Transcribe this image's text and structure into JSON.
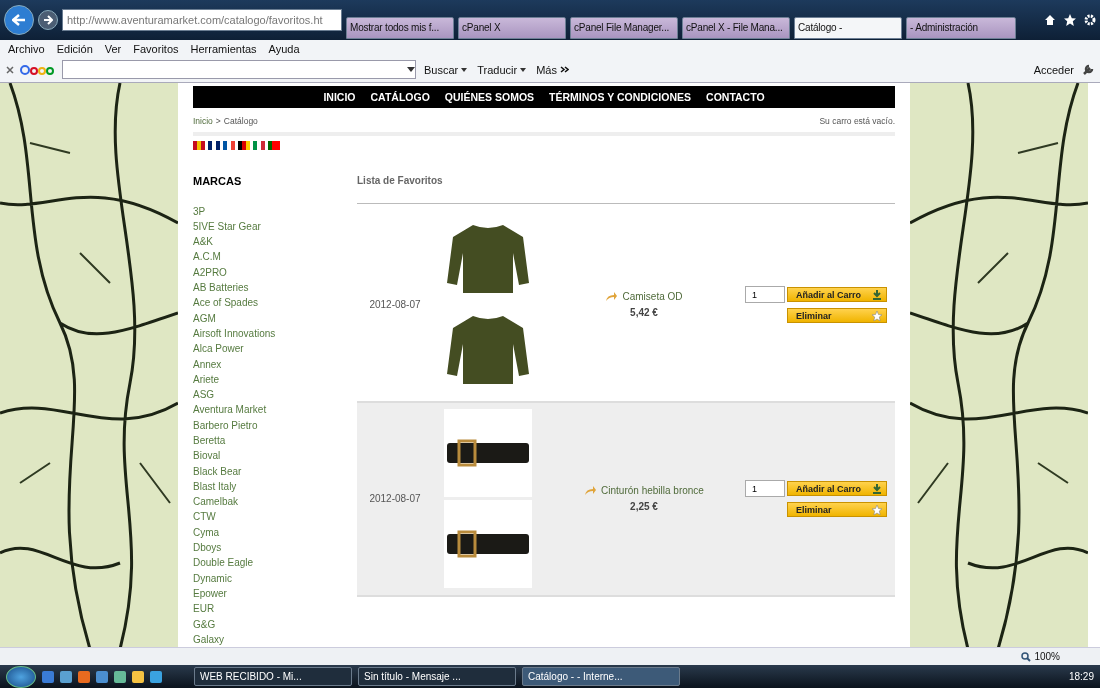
{
  "browser": {
    "address": "http://www.aventuramarket.com/catalogo/favoritos.ht",
    "tabs": [
      {
        "label": "Mostrar todos mis f...",
        "selected": false
      },
      {
        "label": "cPanel X",
        "selected": false
      },
      {
        "label": "cPanel File Manager...",
        "selected": false
      },
      {
        "label": "cPanel X - File Mana...",
        "selected": false
      },
      {
        "label": "Catálogo -",
        "selected": true
      },
      {
        "label": "- Administración",
        "selected": false
      }
    ],
    "menu": [
      "Archivo",
      "Edición",
      "Ver",
      "Favoritos",
      "Herramientas",
      "Ayuda"
    ],
    "toolbar": {
      "search_button": "Buscar",
      "translate_button": "Traducir",
      "more_button": "Más",
      "signin_button": "Acceder"
    }
  },
  "site": {
    "nav": [
      "INICIO",
      "CATÁLOGO",
      "QUIÉNES SOMOS",
      "TÉRMINOS Y CONDICIONES",
      "CONTACTO"
    ],
    "breadcrumb": {
      "home": "Inicio",
      "separator": ">",
      "current": "Catálogo"
    },
    "cart": "Su carro está vacío.",
    "sidebar": {
      "title": "MARCAS",
      "brands": [
        "3P",
        "5IVE Star Gear",
        "A&K",
        "A.C.M",
        "A2PRO",
        "AB Batteries",
        "Ace of Spades",
        "AGM",
        "Airsoft Innovations",
        "Alca Power",
        "Annex",
        "Ariete",
        "ASG",
        "Aventura Market",
        "Barbero Pietro",
        "Beretta",
        "Bioval",
        "Black Bear",
        "Blast Italy",
        "Camelbak",
        "CTW",
        "Cyma",
        "Dboys",
        "Double Eagle",
        "Dynamic",
        "Epower",
        "EUR",
        "G&G",
        "Galaxy"
      ]
    },
    "favorites": {
      "title": "Lista de Favoritos",
      "items": [
        {
          "kind": "shirt",
          "date": "2012-08-07",
          "name": "Camiseta OD",
          "price": "5,42 €",
          "quantity": "1",
          "add_label": "Añadir al Carro",
          "remove_label": "Eliminar",
          "highlighted": false
        },
        {
          "kind": "belt",
          "date": "2012-08-07",
          "name": "Cinturón hebilla bronce",
          "price": "2,25 €",
          "quantity": "1",
          "add_label": "Añadir al Carro",
          "remove_label": "Eliminar",
          "highlighted": true
        }
      ]
    }
  },
  "status_bar": {
    "zoom": "100%"
  },
  "taskbar": {
    "windows": [
      {
        "label": "WEB RECIBIDO - Mi...",
        "selected": false
      },
      {
        "label": "Sin título - Mensaje ...",
        "selected": false
      },
      {
        "label": "Catálogo - - Interne...",
        "selected": true
      }
    ],
    "clock": "18:29"
  }
}
